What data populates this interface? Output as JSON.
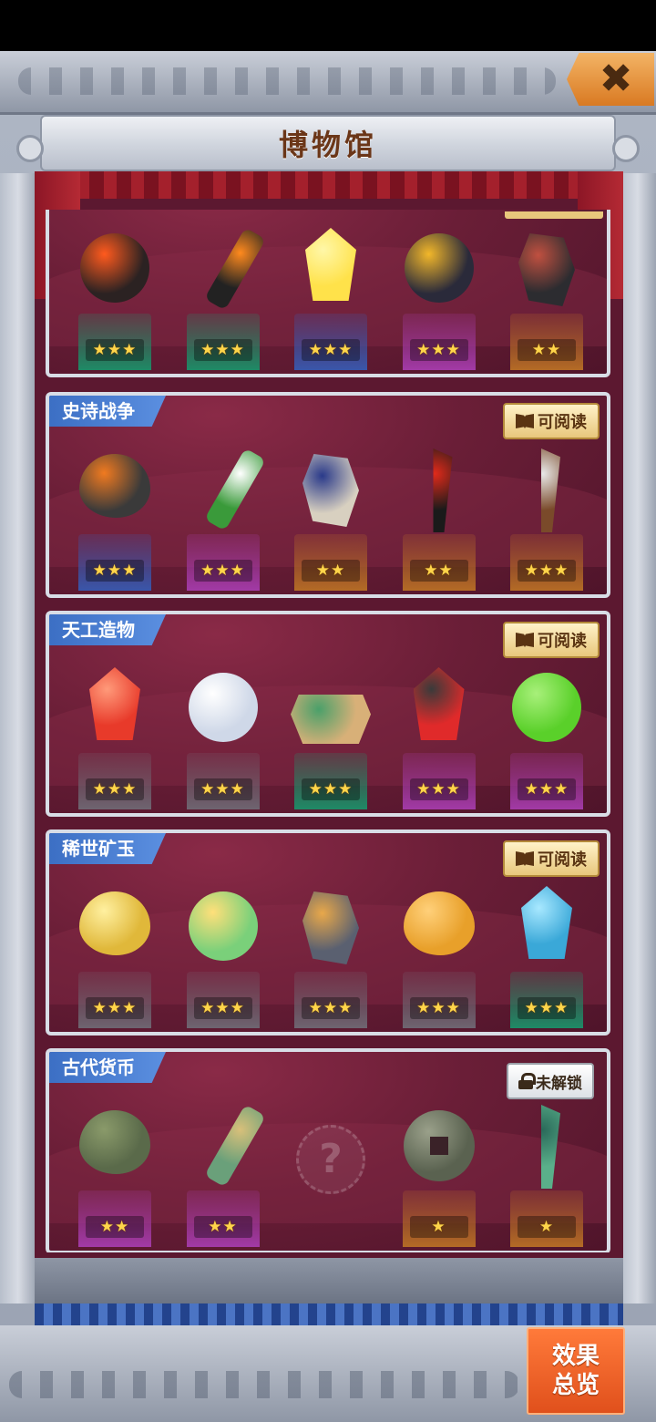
{
  "title": "博物馆",
  "close_label": "✖",
  "effect_overview": [
    "效果",
    "总览"
  ],
  "top_shelf": {
    "items": [
      {
        "name": "lava-spiral-orb",
        "stars": "★★★",
        "pedestal": "green",
        "color": "#2b2222",
        "accent": "#ff5a1e"
      },
      {
        "name": "flame-serpent",
        "stars": "★★★",
        "pedestal": "green",
        "color": "#222",
        "accent": "#ff8a1e"
      },
      {
        "name": "golden-star-crystal",
        "stars": "★★★",
        "pedestal": "blue",
        "color": "#ffe24a",
        "accent": "#fff7a8"
      },
      {
        "name": "ringed-planet",
        "stars": "★★★",
        "pedestal": "purple",
        "color": "#2a2a3a",
        "accent": "#f2b72a"
      },
      {
        "name": "dark-wizard-figure",
        "stars": "★★",
        "pedestal": "orange",
        "color": "#2c2c30",
        "accent": "#c05040"
      }
    ]
  },
  "shelves": [
    {
      "category": "史诗战争",
      "status": "可阅读",
      "status_type": "read",
      "items": [
        {
          "name": "stone-axe-emblem",
          "stars": "★★★",
          "pedestal": "blue",
          "color": "#3a3a3a",
          "accent": "#f07a20"
        },
        {
          "name": "lily-of-the-valley",
          "stars": "★★★",
          "pedestal": "purple",
          "color": "#3a9a3a",
          "accent": "#ffffff"
        },
        {
          "name": "dragon-skull",
          "stars": "★★",
          "pedestal": "orange",
          "color": "#d8d0c0",
          "accent": "#2a3a8a"
        },
        {
          "name": "flame-great-sword",
          "stars": "★★",
          "pedestal": "orange",
          "color": "#1a1a1a",
          "accent": "#e02a1a"
        },
        {
          "name": "feathered-crossbow",
          "stars": "★★★",
          "pedestal": "orange",
          "color": "#7a4a2a",
          "accent": "#e8e8e8"
        }
      ]
    },
    {
      "category": "天工造物",
      "status": "可阅读",
      "status_type": "read",
      "items": [
        {
          "name": "red-rune-crystal",
          "stars": "★★★",
          "pedestal": "gray",
          "color": "#e83a2a",
          "accent": "#ff9a7a"
        },
        {
          "name": "cloud-glass-orb",
          "stars": "★★★",
          "pedestal": "gray",
          "color": "#cfd8e8",
          "accent": "#ffffff"
        },
        {
          "name": "rainbow-sand-box",
          "stars": "★★★",
          "pedestal": "green",
          "color": "#d8b078",
          "accent": "#4aa06a"
        },
        {
          "name": "ruby-on-rock",
          "stars": "★★★",
          "pedestal": "purple",
          "color": "#e02a2a",
          "accent": "#3a3a3a"
        },
        {
          "name": "green-jade-orb",
          "stars": "★★★",
          "pedestal": "purple",
          "color": "#5ad02a",
          "accent": "#a8f07a"
        }
      ]
    },
    {
      "category": "稀世矿玉",
      "status": "可阅读",
      "status_type": "read",
      "items": [
        {
          "name": "gold-stone-egg",
          "stars": "★★★",
          "pedestal": "gray",
          "color": "#e0b83a",
          "accent": "#fff0a0"
        },
        {
          "name": "rainbow-pearl",
          "stars": "★★★",
          "pedestal": "gray",
          "color": "#7ad07a",
          "accent": "#ffe07a"
        },
        {
          "name": "gray-ore-chunk",
          "stars": "★★★",
          "pedestal": "gray",
          "color": "#5a6070",
          "accent": "#e8a84a"
        },
        {
          "name": "amber-swirl-stone",
          "stars": "★★★",
          "pedestal": "gray",
          "color": "#e8a02a",
          "accent": "#ffd07a"
        },
        {
          "name": "aqua-crystal-splash",
          "stars": "★★★",
          "pedestal": "green",
          "color": "#3aa8d8",
          "accent": "#a8e8ff"
        }
      ]
    },
    {
      "category": "古代货币",
      "status": "未解锁",
      "status_type": "locked",
      "items": [
        {
          "name": "bronze-shell-coin",
          "stars": "★★",
          "pedestal": "purple",
          "color": "#5a6a4a",
          "accent": "#8a9a6a"
        },
        {
          "name": "jade-key-coin",
          "stars": "★★",
          "pedestal": "purple",
          "color": "#6aa07a",
          "accent": "#d8c07a"
        },
        {
          "name": "unknown-item",
          "stars": "",
          "pedestal": "none",
          "color": "",
          "accent": ""
        },
        {
          "name": "square-hole-coin",
          "stars": "★",
          "pedestal": "orange",
          "color": "#5a6250",
          "accent": "#9aa08a"
        },
        {
          "name": "jade-knife-coin",
          "stars": "★",
          "pedestal": "orange",
          "color": "#5ab08a",
          "accent": "#2a6a5a"
        }
      ]
    }
  ]
}
